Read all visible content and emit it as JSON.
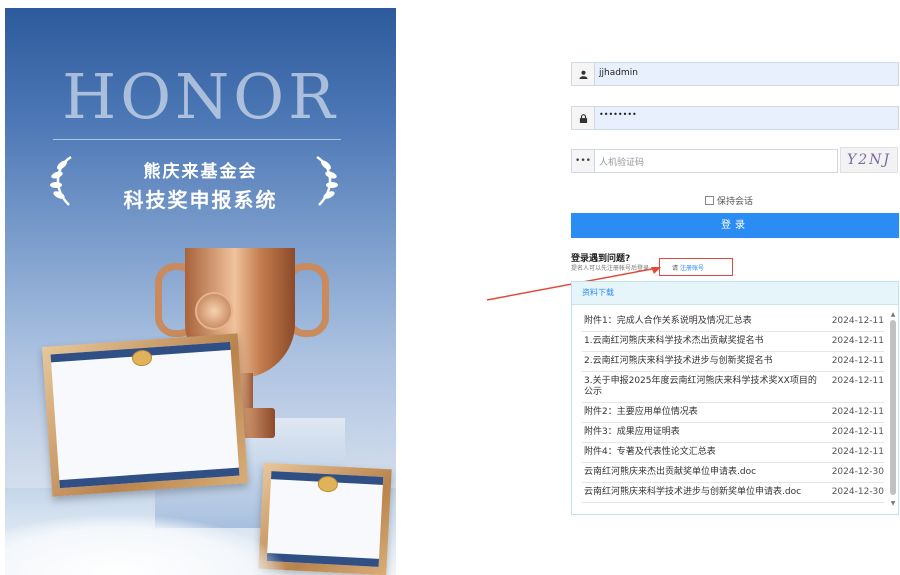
{
  "banner": {
    "brand": "HONOR",
    "title_line1": "熊庆来基金会",
    "title_line2": "科技奖申报系统"
  },
  "login": {
    "username": "jjhadmin",
    "password_mask": "••••••••",
    "captcha_placeholder": "人机验证码",
    "captcha_text": "Y2NJ",
    "remember_label": "保持会话",
    "submit_label": "登录",
    "trouble_title": "登录遇到问题?",
    "trouble_desc": "提名人可以先注册帐号后登录。",
    "register_prefix": "请",
    "register_link": "注册账号"
  },
  "downloads": {
    "header": "资料下载",
    "items": [
      {
        "name": "附件1：完成人合作关系说明及情况汇总表",
        "date": "2024-12-11"
      },
      {
        "name": "1.云南红河熊庆来科学技术杰出贡献奖提名书",
        "date": "2024-12-11"
      },
      {
        "name": "2.云南红河熊庆来科学技术进步与创新奖提名书",
        "date": "2024-12-11"
      },
      {
        "name": "3.关于申报2025年度云南红河熊庆来科学技术奖XX项目的公示",
        "date": "2024-12-11"
      },
      {
        "name": "附件2：主要应用单位情况表",
        "date": "2024-12-11"
      },
      {
        "name": "附件3：成果应用证明表",
        "date": "2024-12-11"
      },
      {
        "name": "附件4：专著及代表性论文汇总表",
        "date": "2024-12-11"
      },
      {
        "name": "云南红河熊庆来杰出贡献奖单位申请表.doc",
        "date": "2024-12-30"
      },
      {
        "name": "云南红河熊庆来科学技术进步与创新奖单位申请表.doc",
        "date": "2024-12-30"
      }
    ]
  },
  "colors": {
    "accent": "#2b8cf3",
    "highlight": "#e24a3b"
  }
}
